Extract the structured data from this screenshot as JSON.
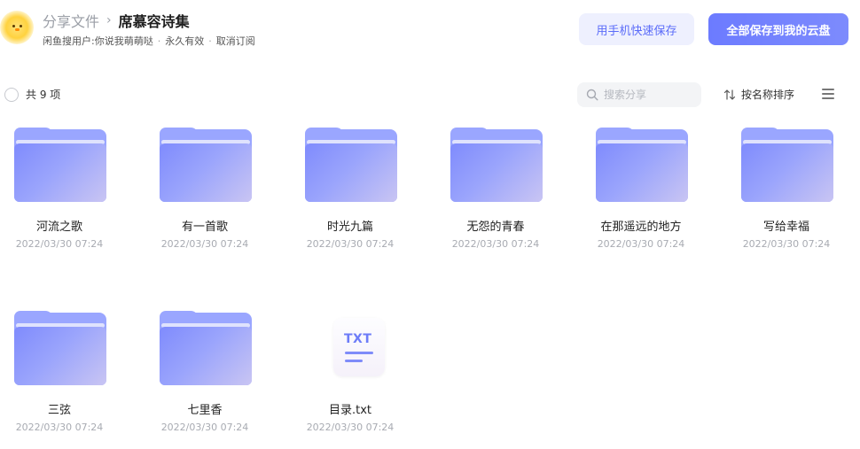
{
  "header": {
    "breadcrumb_root": "分享文件",
    "breadcrumb_separator": "›",
    "breadcrumb_current": "席慕容诗集",
    "sharer": "闲鱼搜用户:你说我萌萌哒",
    "meta_separator": "·",
    "validity": "永久有效",
    "unsubscribe": "取消订阅",
    "phone_save_label": "用手机快速保存",
    "save_all_label": "全部保存到我的云盘"
  },
  "toolbar": {
    "count_text": "共 9 项",
    "search_placeholder": "搜索分享",
    "sort_label": "按名称排序"
  },
  "colors": {
    "accent": "#6c7bff",
    "folder": "#8f9bff",
    "muted_text": "#a8abb2"
  },
  "files": [
    {
      "name": "河流之歌",
      "time": "2022/03/30 07:24",
      "kind": "folder"
    },
    {
      "name": "有一首歌",
      "time": "2022/03/30 07:24",
      "kind": "folder"
    },
    {
      "name": "时光九篇",
      "time": "2022/03/30 07:24",
      "kind": "folder"
    },
    {
      "name": "无怨的青春",
      "time": "2022/03/30 07:24",
      "kind": "folder"
    },
    {
      "name": "在那遥远的地方",
      "time": "2022/03/30 07:24",
      "kind": "folder"
    },
    {
      "name": "写给幸福",
      "time": "2022/03/30 07:24",
      "kind": "folder"
    },
    {
      "name": "三弦",
      "time": "2022/03/30 07:24",
      "kind": "folder"
    },
    {
      "name": "七里香",
      "time": "2022/03/30 07:24",
      "kind": "folder"
    },
    {
      "name": "目录.txt",
      "time": "2022/03/30 07:24",
      "kind": "txt",
      "badge": "TXT"
    }
  ]
}
